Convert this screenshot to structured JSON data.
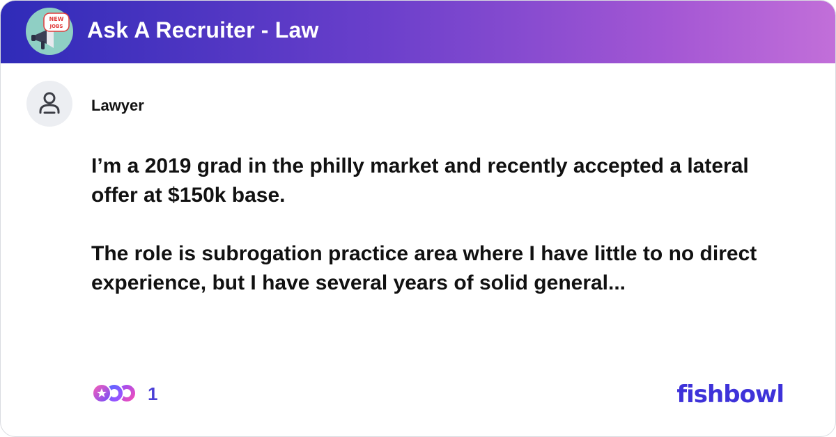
{
  "header": {
    "bowl_title": "Ask A Recruiter - Law",
    "bowl_icon": "megaphone-new-jobs-icon",
    "badge_text": "NEW JOBS",
    "gradient_colors": [
      "#2f2bb8",
      "#6a3fcb",
      "#a457d4",
      "#c26fd9"
    ]
  },
  "post": {
    "author": "Lawyer",
    "avatar_icon": "person-icon",
    "paragraphs": [
      "I’m a 2019 grad in the philly market and recently accepted a lateral offer at $150k base.",
      "The role is subrogation practice area where I have little to no direct experience, but I have several years of solid general..."
    ]
  },
  "footer": {
    "reaction_icons": [
      "star-reaction-icon",
      "thumbs-reaction-icon",
      "heart-reaction-icon"
    ],
    "reaction_count": "1",
    "logo": "fishbowl",
    "logo_color": "#3e32d9"
  }
}
